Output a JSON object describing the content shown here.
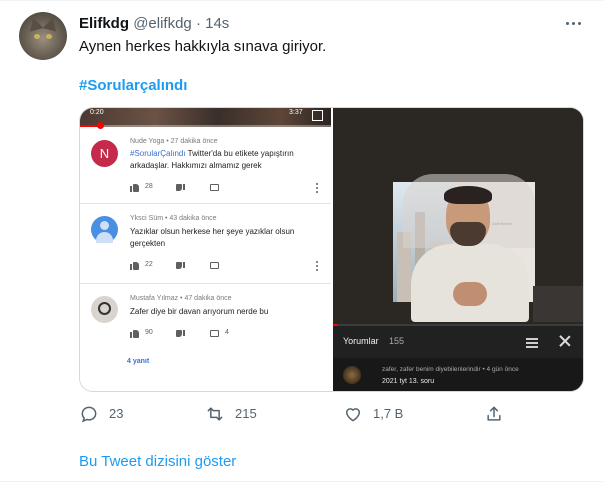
{
  "tweet": {
    "author_name": "Elifkdg",
    "author_handle": "@elifkdg",
    "separator": "·",
    "time": "14s",
    "text": "Aynen herkes hakkıyla sınava giriyor.",
    "hashtag": "#Sorularçalındı",
    "show_thread": "Bu Tweet dizisini göster"
  },
  "actions": {
    "replies": "23",
    "retweets": "215",
    "likes": "1,7 B"
  },
  "media_left": {
    "video_time_start": "0:20",
    "video_time_end": "3:37",
    "video_progress": 0.08,
    "comments": [
      {
        "avatar_letter": "N",
        "meta": "Nude Yoga • 27 dakika önce",
        "tag": "#SorularÇalındı",
        "body_after_tag": " Twitter'da bu etikete yapıştırın",
        "body_line2": "arkadaşlar. Hakkımızı almamız gerek",
        "likes": "28",
        "replies": ""
      },
      {
        "meta": "Yksci Süm • 43 dakika önce",
        "body": "Yazıklar olsun herkese her şeye yazıklar olsun",
        "body_line2": "gerçekten",
        "likes": "22",
        "replies": ""
      },
      {
        "meta": "Mustafa Yılmaz • 47 dakika önce",
        "body": "Zafer diye bir davan arıyorum nerde bu",
        "likes": "90",
        "replies": "4"
      }
    ],
    "replies_link": "4 yanıt"
  },
  "media_right": {
    "comments_label": "Yorumlar",
    "comments_count": "155",
    "comment_meta": "zafer, zafer benim diyebilenlerindir • 4 gün önce",
    "comment_body": "2021 tyt 13. soru",
    "logo_text": "ZaferBenim"
  },
  "colors": {
    "accent": "#1d9bf0",
    "avatar_n": "#c62a4a",
    "avatar_person": "#4a90e2",
    "youtube_red": "#ff0000"
  }
}
